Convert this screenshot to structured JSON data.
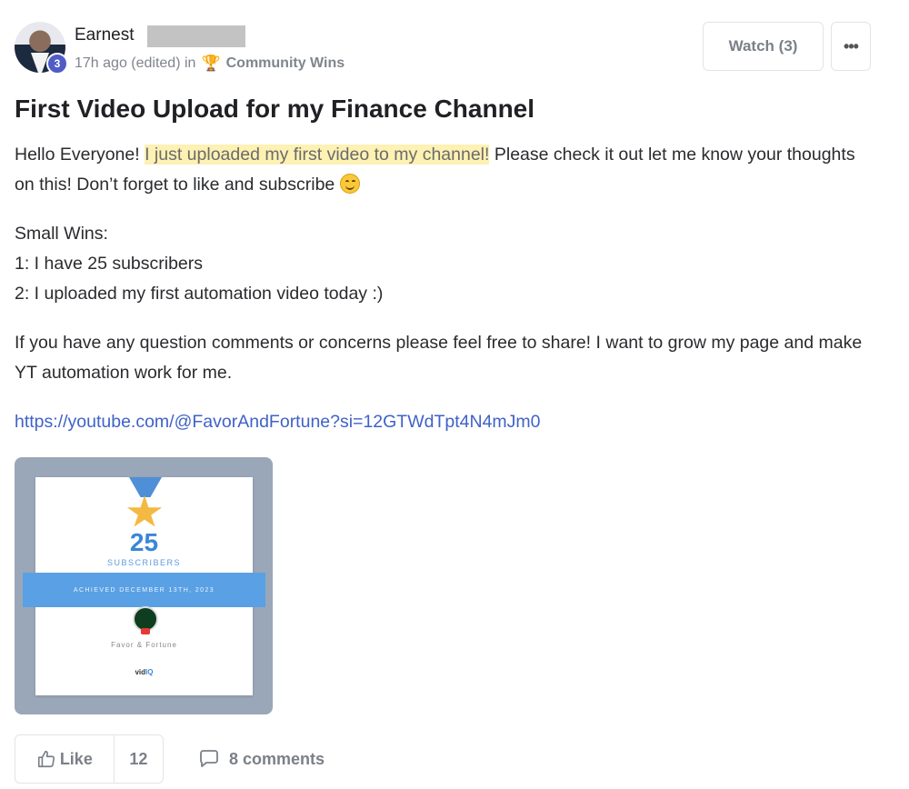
{
  "post": {
    "author": {
      "name": "Earnest",
      "level": "3"
    },
    "meta": {
      "time": "17h ago (edited) in",
      "category": "Community Wins",
      "category_icon": "trophy-icon"
    },
    "watch_label": "Watch (3)",
    "more_label": "•••",
    "title": "First Video Upload for my Finance Channel",
    "body": {
      "p1_a": "Hello Everyone! ",
      "p1_highlight": "I just uploaded my first video to my channel!",
      "p1_b": " Please check it out let me know your thoughts on this! Don’t forget to like and subscribe ",
      "p2_line1": "Small Wins:",
      "p2_line2": "1: I have 25 subscribers",
      "p2_line3": "2: I uploaded my first automation video today :)",
      "p3": "If you have any question comments or concerns please feel free to share! I want to grow my page and make YT automation work for me.",
      "link": "https://youtube.com/@FavorAndFortune?si=12GTWdTpt4N4mJm0"
    },
    "image": {
      "count": "25",
      "label": "SUBSCRIBERS",
      "achieved": "ACHIEVED DECEMBER 13TH, 2023",
      "channel": "Favor & Fortune",
      "brand_a": "vid",
      "brand_b": "IQ"
    },
    "actions": {
      "like_label": "Like",
      "like_count": "12",
      "comments_label": "8 comments"
    }
  },
  "colors": {
    "accent_link": "#3f62c8",
    "highlight": "#fdf1b3",
    "badge": "#4f5cc8"
  }
}
